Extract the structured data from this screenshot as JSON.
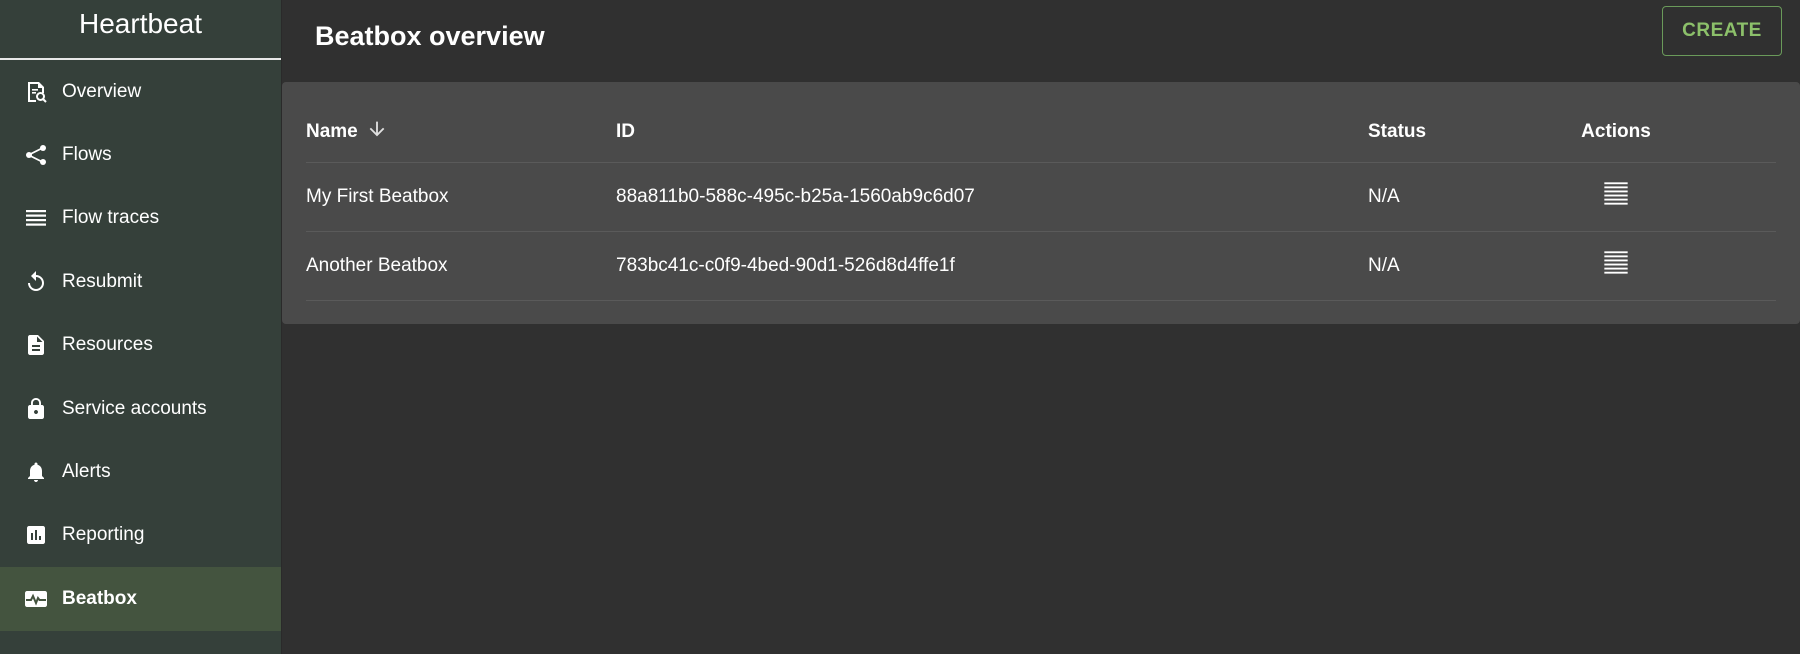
{
  "app": {
    "title": "Heartbeat"
  },
  "sidebar": {
    "items": [
      {
        "label": "Overview",
        "icon": "overview-icon"
      },
      {
        "label": "Flows",
        "icon": "share-icon"
      },
      {
        "label": "Flow traces",
        "icon": "list-icon"
      },
      {
        "label": "Resubmit",
        "icon": "refresh-icon"
      },
      {
        "label": "Resources",
        "icon": "document-icon"
      },
      {
        "label": "Service accounts",
        "icon": "lock-icon"
      },
      {
        "label": "Alerts",
        "icon": "bell-icon"
      },
      {
        "label": "Reporting",
        "icon": "bar-chart-icon"
      },
      {
        "label": "Beatbox",
        "icon": "heartbeat-icon",
        "active": true
      }
    ]
  },
  "header": {
    "title": "Beatbox overview",
    "create_label": "CREATE"
  },
  "table": {
    "columns": {
      "name": "Name",
      "id": "ID",
      "status": "Status",
      "actions": "Actions"
    },
    "rows": [
      {
        "name": "My First Beatbox",
        "id": "88a811b0-588c-495c-b25a-1560ab9c6d07",
        "status": "N/A"
      },
      {
        "name": "Another Beatbox",
        "id": "783bc41c-c0f9-4bed-90d1-526d8d4ffe1f",
        "status": "N/A"
      }
    ]
  },
  "colors": {
    "sidebar_bg": "#35403a",
    "active_bg": "#44543f",
    "accent": "#8cc06a",
    "main_bg": "#303030",
    "panel_bg": "#4a4a4a"
  }
}
